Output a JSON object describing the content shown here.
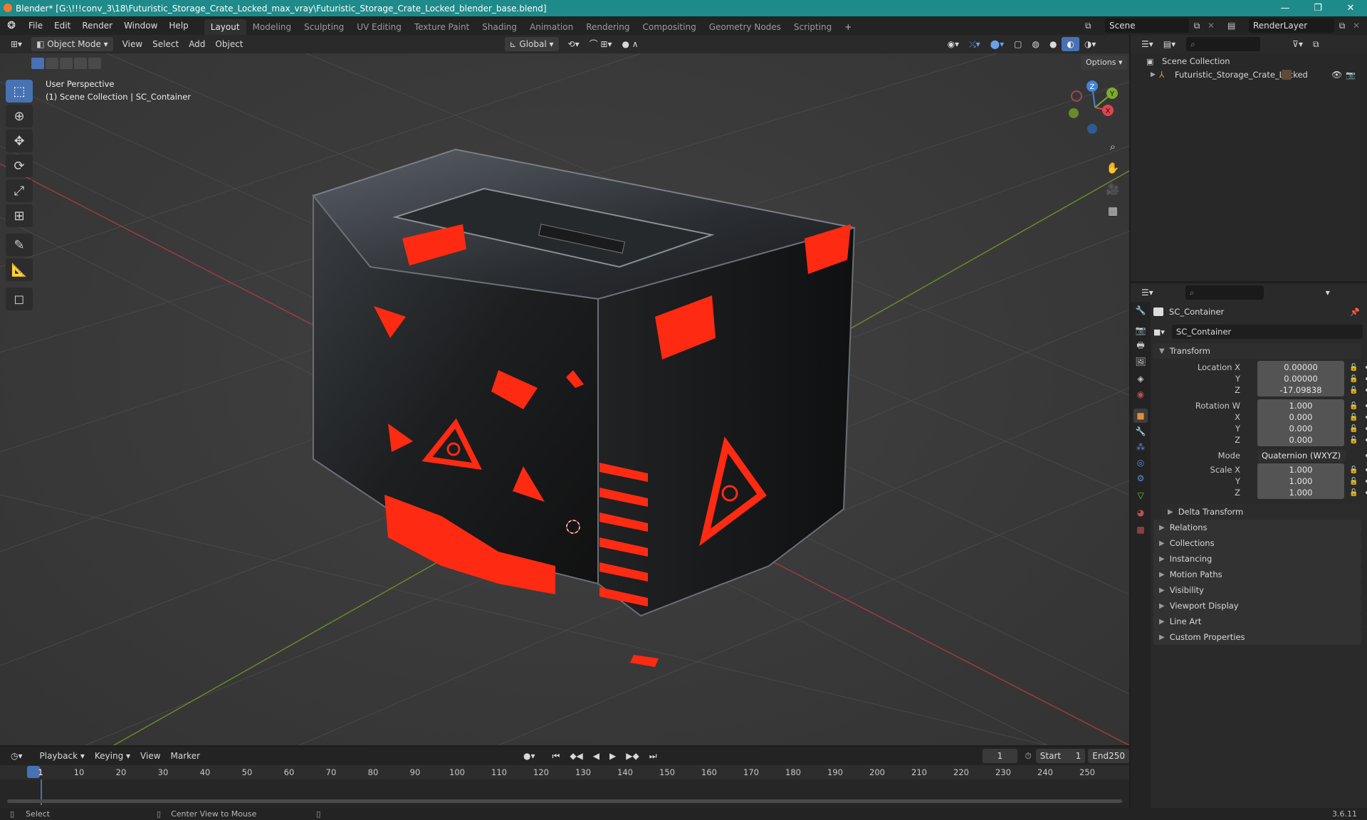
{
  "window": {
    "title": "Blender* [G:\\!!!conv_3\\18\\Futuristic_Storage_Crate_Locked_max_vray\\Futuristic_Storage_Crate_Locked_blender_base.blend]",
    "minimize": "—",
    "maximize": "❐",
    "close": "✕"
  },
  "menu": [
    "File",
    "Edit",
    "Render",
    "Window",
    "Help"
  ],
  "workspaces": [
    "Layout",
    "Modeling",
    "Sculpting",
    "UV Editing",
    "Texture Paint",
    "Shading",
    "Animation",
    "Rendering",
    "Compositing",
    "Geometry Nodes",
    "Scripting"
  ],
  "active_workspace": "Layout",
  "add_workspace": "+",
  "scene_name": "Scene",
  "render_layer": "RenderLayer",
  "viewport": {
    "mode": "Object Mode",
    "menus": [
      "View",
      "Select",
      "Add",
      "Object"
    ],
    "orientation": "Global",
    "options_label": "Options",
    "overlay_line1": "User Perspective",
    "overlay_line2": "(1) Scene Collection | SC_Container",
    "gizmo_axes": {
      "x": "X",
      "y": "Y",
      "z": "Z"
    }
  },
  "outliner": {
    "root": "Scene Collection",
    "item": "Futuristic_Storage_Crate_Locked"
  },
  "properties": {
    "object_name": "SC_Container",
    "data_name": "SC_Container",
    "transform_label": "Transform",
    "location_x_label": "Location X",
    "location_x": "0.00000",
    "location_y_label": "Y",
    "location_y": "0.00000",
    "location_z_label": "Z",
    "location_z": "-17.09838",
    "rotation_w_label": "Rotation W",
    "rotation_w": "1.000",
    "rotation_x_label": "X",
    "rotation_x": "0.000",
    "rotation_y_label": "Y",
    "rotation_y": "0.000",
    "rotation_z_label": "Z",
    "rotation_z": "0.000",
    "mode_label": "Mode",
    "mode": "Quaternion (WXYZ)",
    "scale_x_label": "Scale X",
    "scale_x": "1.000",
    "scale_y_label": "Y",
    "scale_y": "1.000",
    "scale_z_label": "Z",
    "scale_z": "1.000",
    "delta_transform": "Delta Transform",
    "panels": [
      "Relations",
      "Collections",
      "Instancing",
      "Motion Paths",
      "Visibility",
      "Viewport Display",
      "Line Art",
      "Custom Properties"
    ]
  },
  "timeline": {
    "menus": [
      "Playback",
      "Keying",
      "View",
      "Marker"
    ],
    "current_frame": "1",
    "start_label": "Start",
    "start": "1",
    "end_label": "End",
    "end": "250",
    "ruler": [
      "1",
      "10",
      "20",
      "30",
      "40",
      "50",
      "60",
      "70",
      "80",
      "90",
      "100",
      "110",
      "120",
      "130",
      "140",
      "150",
      "160",
      "170",
      "180",
      "190",
      "200",
      "210",
      "220",
      "230",
      "240",
      "250"
    ]
  },
  "statusbar": {
    "select": "Select",
    "center_view": "Center View to Mouse",
    "version": "3.6.11"
  },
  "colors": {
    "title_bar": "#1f8a8a",
    "accent": "#4772b3",
    "crate_red": "#ff2a12",
    "axis_x": "#e0454f",
    "axis_y": "#7bab2b",
    "axis_z": "#3f86d9"
  }
}
